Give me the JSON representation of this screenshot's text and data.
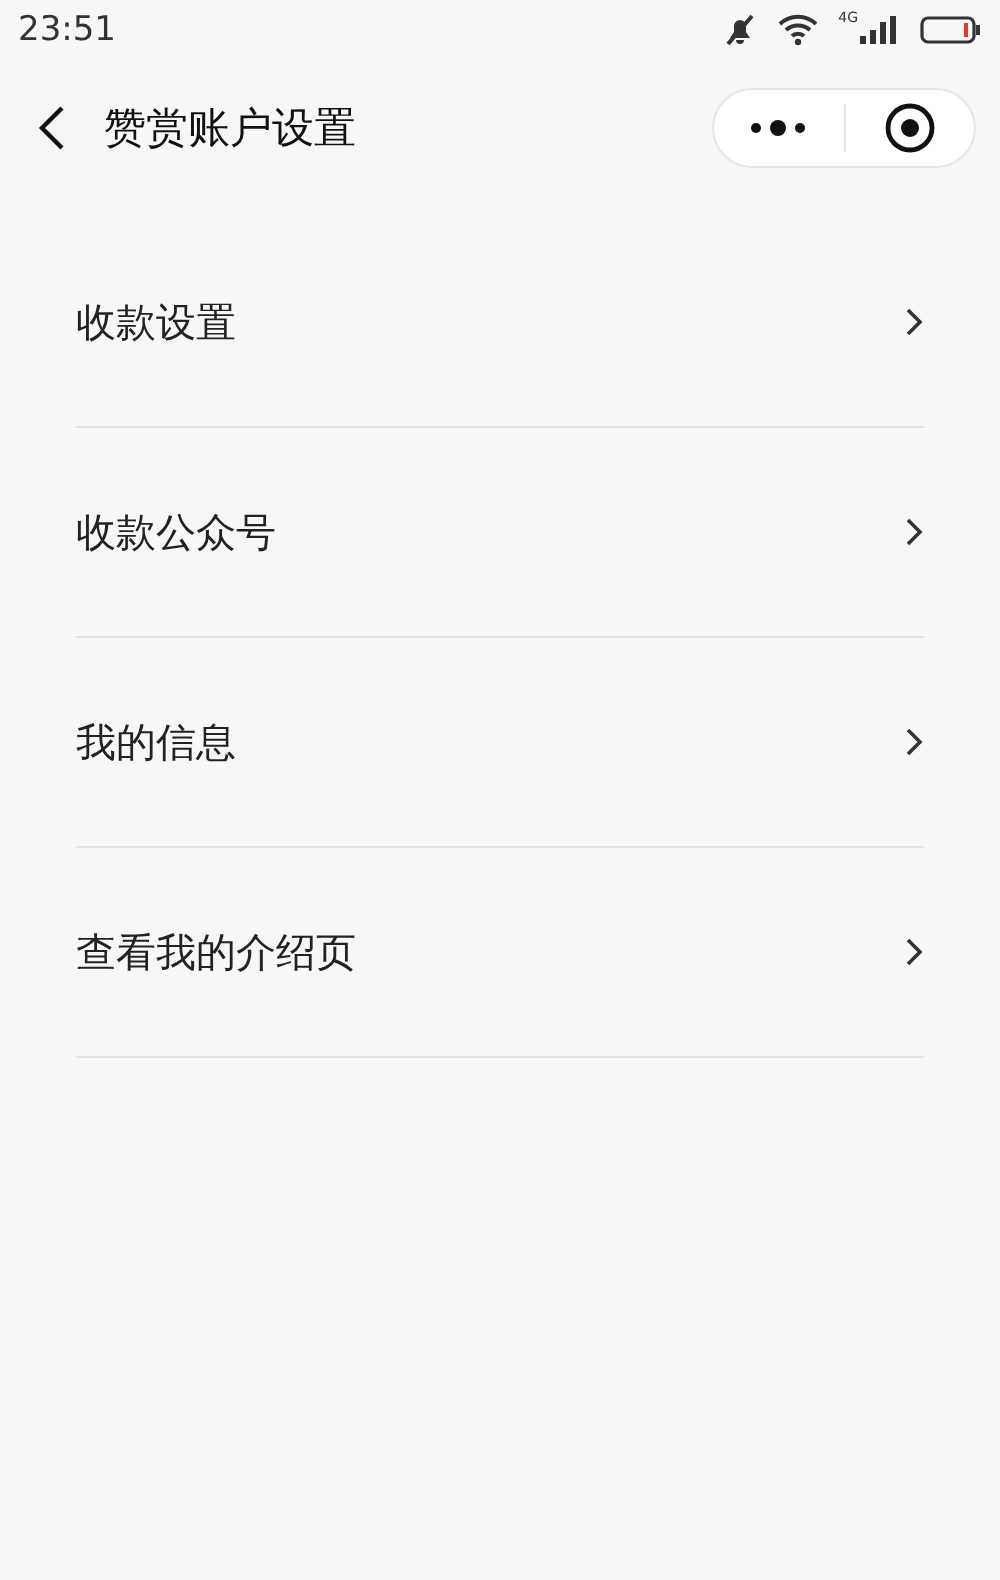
{
  "status_bar": {
    "time": "23:51",
    "network": "4G"
  },
  "header": {
    "title": "赞赏账户设置"
  },
  "menu_items": [
    {
      "label": "收款设置"
    },
    {
      "label": "收款公众号"
    },
    {
      "label": "我的信息"
    },
    {
      "label": "查看我的介绍页"
    }
  ]
}
